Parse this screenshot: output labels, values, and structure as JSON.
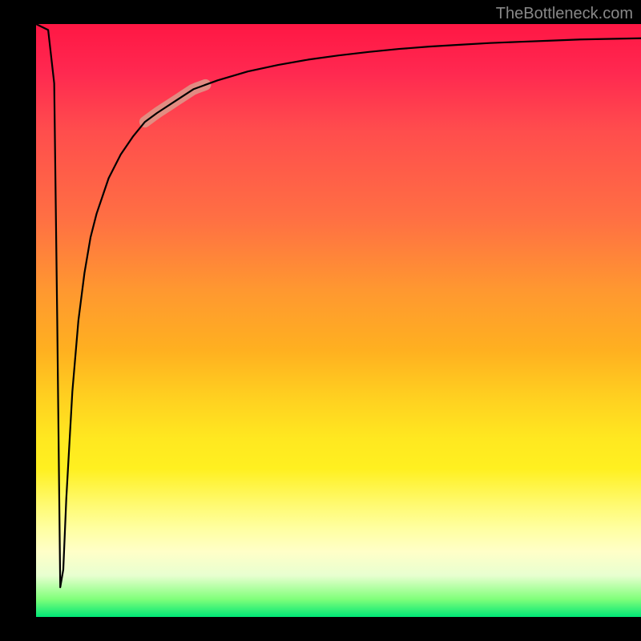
{
  "attribution": "TheBottleneck.com",
  "chart_data": {
    "type": "line",
    "title": "",
    "xlabel": "",
    "ylabel": "",
    "xlim": [
      0,
      100
    ],
    "ylim": [
      0,
      100
    ],
    "background_gradient": {
      "top": "#ff1744",
      "mid": "#ffeb3b",
      "bottom": "#00e676"
    },
    "series": [
      {
        "name": "bottleneck-curve",
        "x": [
          0,
          2,
          3,
          3.5,
          4,
          4.5,
          5,
          6,
          7,
          8,
          9,
          10,
          12,
          14,
          16,
          18,
          20,
          23,
          26,
          30,
          35,
          40,
          45,
          50,
          55,
          60,
          65,
          70,
          75,
          80,
          85,
          90,
          95,
          100
        ],
        "y": [
          100,
          99,
          90,
          50,
          5,
          8,
          20,
          38,
          50,
          58,
          64,
          68,
          74,
          78,
          81,
          83.5,
          85,
          87,
          89,
          90.5,
          92,
          93.1,
          94,
          94.7,
          95.3,
          95.8,
          96.2,
          96.5,
          96.8,
          97.0,
          97.2,
          97.4,
          97.5,
          97.6
        ]
      }
    ],
    "highlight_segment": {
      "x_start": 18,
      "x_end": 28
    }
  }
}
